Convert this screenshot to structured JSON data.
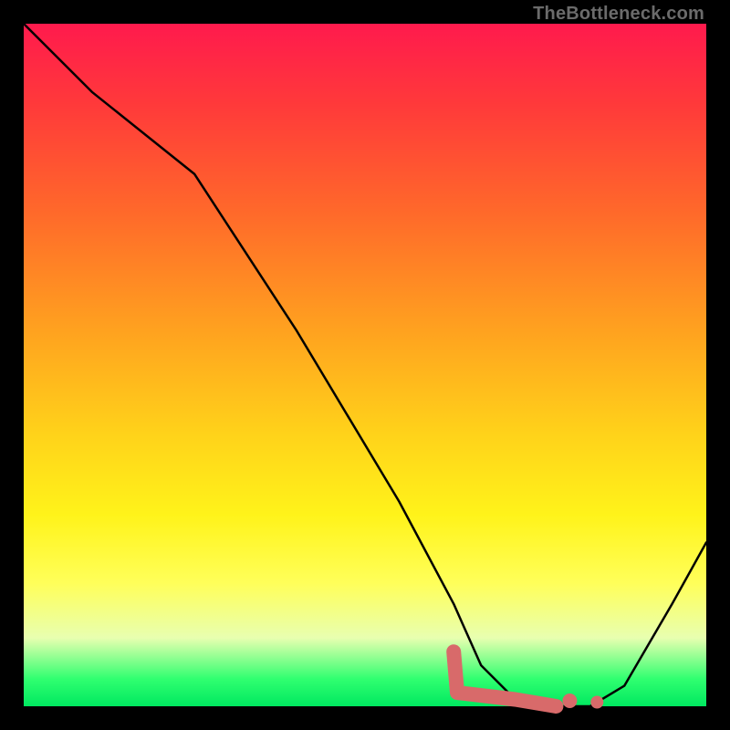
{
  "watermark": "TheBottleneck.com",
  "colors": {
    "curve": "#000000",
    "marker": "#d86a6a",
    "frame_bg": "#000000",
    "gradient_top": "#ff1a4d",
    "gradient_bottom": "#00e860"
  },
  "chart_data": {
    "type": "line",
    "title": "",
    "xlabel": "",
    "ylabel": "",
    "xlim": [
      0,
      100
    ],
    "ylim": [
      0,
      100
    ],
    "grid": false,
    "legend": false,
    "series": [
      {
        "name": "bottleneck-curve",
        "x": [
          0,
          10,
          25,
          40,
          55,
          63,
          67,
          72,
          78,
          83,
          88,
          95,
          100
        ],
        "y": [
          100,
          90,
          78,
          55,
          30,
          15,
          6,
          1,
          0,
          0,
          3,
          15,
          24
        ]
      }
    ],
    "markers": [
      {
        "name": "fuzzy-segment",
        "points": [
          {
            "x": 63,
            "y": 8
          },
          {
            "x": 63.5,
            "y": 2
          },
          {
            "x": 72,
            "y": 1
          },
          {
            "x": 78,
            "y": 0
          }
        ]
      },
      {
        "name": "dot-1",
        "x": 80,
        "y": 0.8
      },
      {
        "name": "dot-2",
        "x": 84,
        "y": 0.6
      }
    ],
    "background_gradient": {
      "stops": [
        {
          "pos": 0,
          "color": "#ff1a4d"
        },
        {
          "pos": 12,
          "color": "#ff3a3a"
        },
        {
          "pos": 28,
          "color": "#ff6a2a"
        },
        {
          "pos": 45,
          "color": "#ffa21f"
        },
        {
          "pos": 60,
          "color": "#ffd21a"
        },
        {
          "pos": 72,
          "color": "#fff31a"
        },
        {
          "pos": 82,
          "color": "#ffff5a"
        },
        {
          "pos": 90,
          "color": "#e8ffb0"
        },
        {
          "pos": 96,
          "color": "#30ff70"
        },
        {
          "pos": 100,
          "color": "#00e860"
        }
      ]
    }
  }
}
